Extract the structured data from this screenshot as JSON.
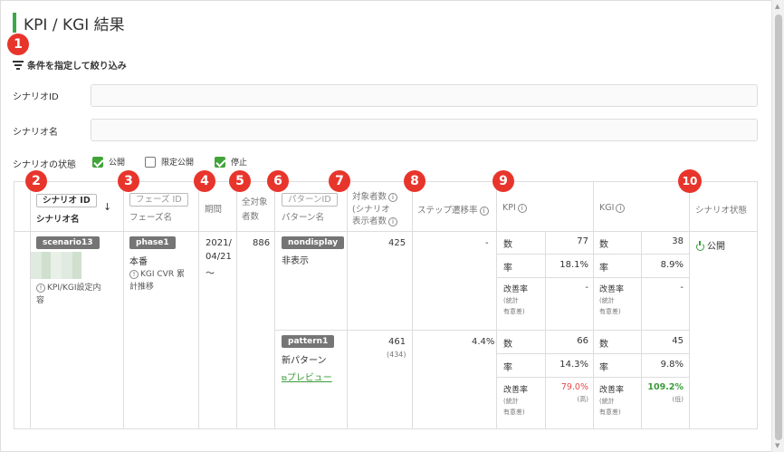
{
  "page": {
    "title": "KPI / KGI 結果"
  },
  "filter": {
    "label": "条件を指定して絞り込み",
    "scenario_id_label": "シナリオID",
    "scenario_name_label": "シナリオ名",
    "status_label": "シナリオの状態",
    "status_options": [
      {
        "label": "公開",
        "checked": true
      },
      {
        "label": "限定公開",
        "checked": false
      },
      {
        "label": "停止",
        "checked": true
      }
    ]
  },
  "badges": [
    "1",
    "2",
    "3",
    "4",
    "5",
    "6",
    "7",
    "8",
    "9",
    "10"
  ],
  "columns": {
    "scenario_id": "シナリオ ID",
    "scenario_name": "シナリオ名",
    "sort_arrow": "↓",
    "phase_id": "フェーズ ID",
    "phase_name": "フェーズ名",
    "period": "期間",
    "total_1": "全対象",
    "total_2": "者数",
    "pattern_id": "パターンID",
    "pattern_name": "パターン名",
    "target_1": "対象者数",
    "target_2": "(シナリオ",
    "target_3": "表示者数",
    "step_rate": "ステップ遷移率",
    "kpi": "KPI",
    "kgi": "KGI",
    "scenario_status": "シナリオ状態"
  },
  "row": {
    "scenario_id": "scenario13",
    "kpi_setting": "KPI/KGI設定内",
    "kpi_setting_2": "容",
    "phase_id": "phase1",
    "phase_name": "本番",
    "phase_note_1": "KGI CVR 累",
    "phase_note_2": "計推移",
    "period_1": "2021/",
    "period_2": "04/21",
    "period_3": "〜",
    "total": "886",
    "status": "公開",
    "patterns": [
      {
        "id": "nondisplay",
        "name": "非表示",
        "target": "425",
        "target_sub": "",
        "step_rate": "-",
        "kpi": {
          "count_label": "数",
          "count": "77",
          "rate_label": "率",
          "rate": "18.1%",
          "imp_label": "改善率",
          "imp_sub1": "(統計",
          "imp_sub2": "有意差)",
          "imp": "-",
          "imp_note": ""
        },
        "kgi": {
          "count_label": "数",
          "count": "38",
          "rate_label": "率",
          "rate": "8.9%",
          "imp_label": "改善率",
          "imp_sub1": "(統計",
          "imp_sub2": "有意差)",
          "imp": "-",
          "imp_note": ""
        }
      },
      {
        "id": "pattern1",
        "name": "新パターン",
        "preview": "プレビュー",
        "target": "461",
        "target_sub": "(434)",
        "step_rate": "4.4%",
        "kpi": {
          "count_label": "数",
          "count": "66",
          "rate_label": "率",
          "rate": "14.3%",
          "imp_label": "改善率",
          "imp_sub1": "(統計",
          "imp_sub2": "有意差)",
          "imp": "79.0%",
          "imp_note": "(高)"
        },
        "kgi": {
          "count_label": "数",
          "count": "45",
          "rate_label": "率",
          "rate": "9.8%",
          "imp_label": "改善率",
          "imp_sub1": "(統計",
          "imp_sub2": "有意差)",
          "imp": "109.2%",
          "imp_note": "(低)"
        }
      }
    ]
  },
  "colors": {
    "accent": "#3aa84b",
    "badge": "#e8352c",
    "tag": "#757575",
    "negative": "#e84c4c",
    "positive": "#3a9c3a"
  }
}
